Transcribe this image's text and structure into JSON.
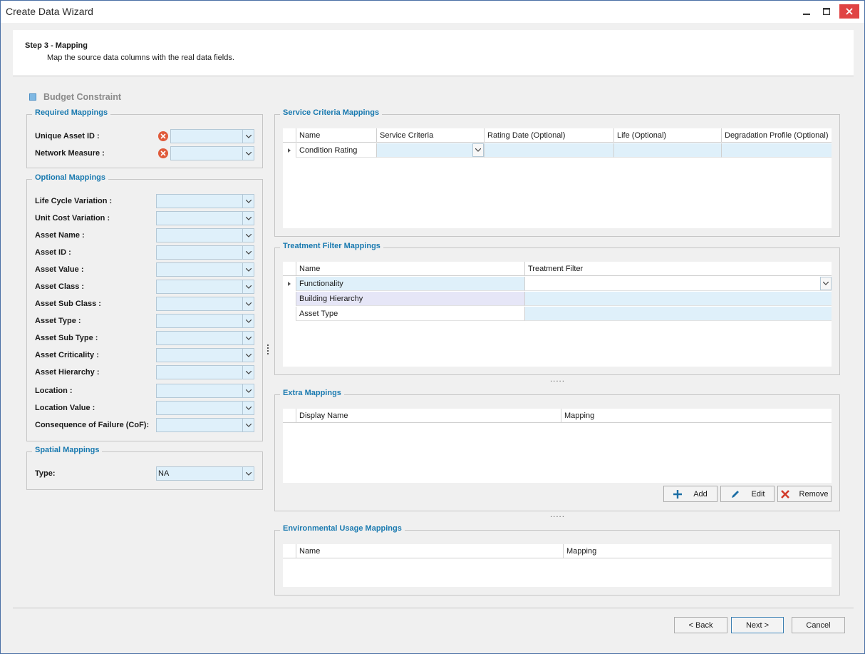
{
  "window": {
    "title": "Create Data Wizard"
  },
  "header": {
    "step_title": "Step 3 - Mapping",
    "step_description": "Map the source data columns with the real data fields."
  },
  "section_tag": {
    "label": "Budget Constraint",
    "color": "#7fb8e3"
  },
  "required": {
    "title": "Required Mappings",
    "fields": [
      {
        "label": "Unique Asset ID :",
        "value": ""
      },
      {
        "label": "Network Measure :",
        "value": ""
      }
    ]
  },
  "optional": {
    "title": "Optional Mappings",
    "fields": [
      {
        "label": "Life Cycle Variation :",
        "value": ""
      },
      {
        "label": "Unit Cost Variation :",
        "value": ""
      },
      {
        "label": "Asset Name :",
        "value": ""
      },
      {
        "label": "Asset ID :",
        "value": ""
      },
      {
        "label": "Asset Value :",
        "value": ""
      },
      {
        "label": "Asset Class :",
        "value": ""
      },
      {
        "label": "Asset Sub Class :",
        "value": ""
      },
      {
        "label": "Asset Type :",
        "value": ""
      },
      {
        "label": "Asset Sub Type :",
        "value": ""
      },
      {
        "label": "Asset Criticality :",
        "value": ""
      },
      {
        "label": "Asset Hierarchy :",
        "value": ""
      },
      {
        "label": "Location :",
        "value": ""
      },
      {
        "label": "Location Value :",
        "value": ""
      },
      {
        "label": "Consequence of Failure (CoF):",
        "value": ""
      }
    ]
  },
  "spatial": {
    "title": "Spatial Mappings",
    "type_label": "Type:",
    "type_value": "NA"
  },
  "service_criteria": {
    "title": "Service Criteria Mappings",
    "columns": [
      "Name",
      "Service Criteria",
      "Rating Date (Optional)",
      "Life (Optional)",
      "Degradation Profile (Optional)"
    ],
    "rows": [
      [
        "Condition Rating",
        "",
        "",
        "",
        ""
      ]
    ]
  },
  "treatment_filter": {
    "title": "Treatment Filter Mappings",
    "columns": [
      "Name",
      "Treatment Filter"
    ],
    "rows": [
      [
        "Functionality",
        ""
      ],
      [
        "Building Hierarchy",
        ""
      ],
      [
        "Asset Type",
        ""
      ]
    ]
  },
  "extra": {
    "title": "Extra Mappings",
    "columns": [
      "Display Name",
      "Mapping"
    ],
    "buttons": {
      "add": "Add",
      "edit": "Edit",
      "remove": "Remove"
    }
  },
  "environmental": {
    "title": "Environmental Usage Mappings",
    "columns": [
      "Name",
      "Mapping"
    ]
  },
  "splitter_glyph": ".....",
  "footer": {
    "back": "< Back",
    "next": "Next >",
    "cancel": "Cancel"
  },
  "colors": {
    "accent": "#1a7ab0",
    "field_bg": "#dff0fa",
    "error": "#e05a3a",
    "close": "#e04343"
  }
}
